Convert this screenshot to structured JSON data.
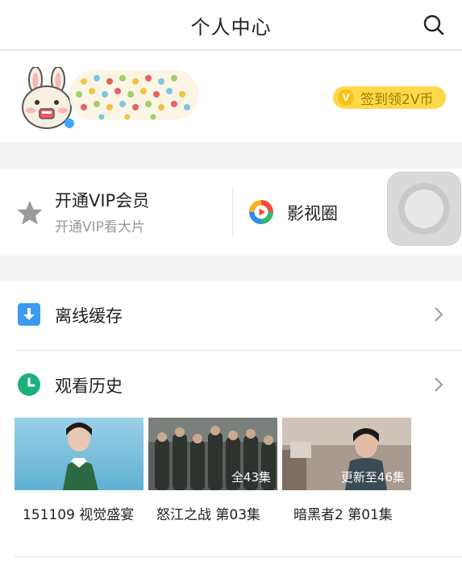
{
  "header": {
    "title": "个人中心",
    "search_icon": "search-icon"
  },
  "profile": {
    "avatar_icon": "cartoon-bunny-avatar",
    "checkin_badge_glyph": "V",
    "checkin_label": "签到领2V币",
    "checkin_color": "#ffd84a"
  },
  "vip": {
    "title": "开通VIP会员",
    "subtitle": "开通VIP看大片",
    "star_icon": "star-icon"
  },
  "circle": {
    "label": "影视圈",
    "icon": "video-circle-icon"
  },
  "offline": {
    "label": "离线缓存",
    "icon": "download-icon",
    "icon_color": "#3a9bf0"
  },
  "history": {
    "label": "观看历史",
    "icon": "clock-icon",
    "icon_color": "#1db07a",
    "items": [
      {
        "caption": "151109 视觉盛宴",
        "badge": ""
      },
      {
        "caption": "怒江之战 第03集",
        "badge": "全43集"
      },
      {
        "caption": "暗黑者2 第01集",
        "badge": "更新至46集"
      }
    ]
  }
}
